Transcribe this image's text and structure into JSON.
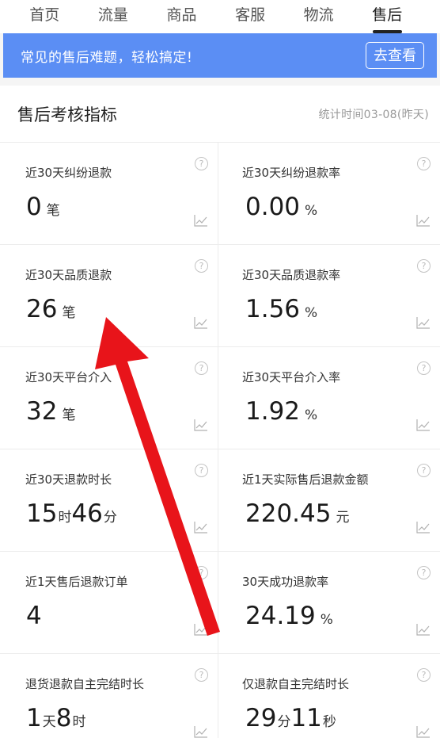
{
  "tabs": [
    "首页",
    "流量",
    "商品",
    "客服",
    "物流",
    "售后"
  ],
  "banner": {
    "text": "常见的售后难题，轻松搞定!",
    "button": "去查看"
  },
  "section": {
    "title": "售后考核指标",
    "time": "统计时间03-08(昨天)"
  },
  "cards": [
    {
      "label": "近30天纠纷退款",
      "value": [
        {
          "n": "0",
          "u": "笔"
        }
      ]
    },
    {
      "label": "近30天纠纷退款率",
      "value": [
        {
          "n": "0.00",
          "u": "%"
        }
      ]
    },
    {
      "label": "近30天品质退款",
      "value": [
        {
          "n": "26",
          "u": "笔"
        }
      ]
    },
    {
      "label": "近30天品质退款率",
      "value": [
        {
          "n": "1.56",
          "u": "%"
        }
      ]
    },
    {
      "label": "近30天平台介入",
      "value": [
        {
          "n": "32",
          "u": "笔"
        }
      ]
    },
    {
      "label": "近30天平台介入率",
      "value": [
        {
          "n": "1.92",
          "u": "%"
        }
      ]
    },
    {
      "label": "近30天退款时长",
      "value": [
        {
          "n": "15",
          "u": "时"
        },
        {
          "n": "46",
          "u": "分"
        }
      ]
    },
    {
      "label": "近1天实际售后退款金额",
      "value": [
        {
          "n": "220.45",
          "u": "元"
        }
      ]
    },
    {
      "label": "近1天售后退款订单",
      "value": [
        {
          "n": "4",
          "u": ""
        }
      ]
    },
    {
      "label": "30天成功退款率",
      "value": [
        {
          "n": "24.19",
          "u": "%"
        }
      ]
    },
    {
      "label": "退货退款自主完结时长",
      "value": [
        {
          "n": "1",
          "u": "天"
        },
        {
          "n": "8",
          "u": "时"
        }
      ]
    },
    {
      "label": "仅退款自主完结时长",
      "value": [
        {
          "n": "29",
          "u": "分"
        },
        {
          "n": "11",
          "u": "秒"
        }
      ]
    }
  ],
  "help_icon": "?",
  "colors": {
    "banner": "#5b8ef4",
    "arrow": "#e8141a"
  }
}
